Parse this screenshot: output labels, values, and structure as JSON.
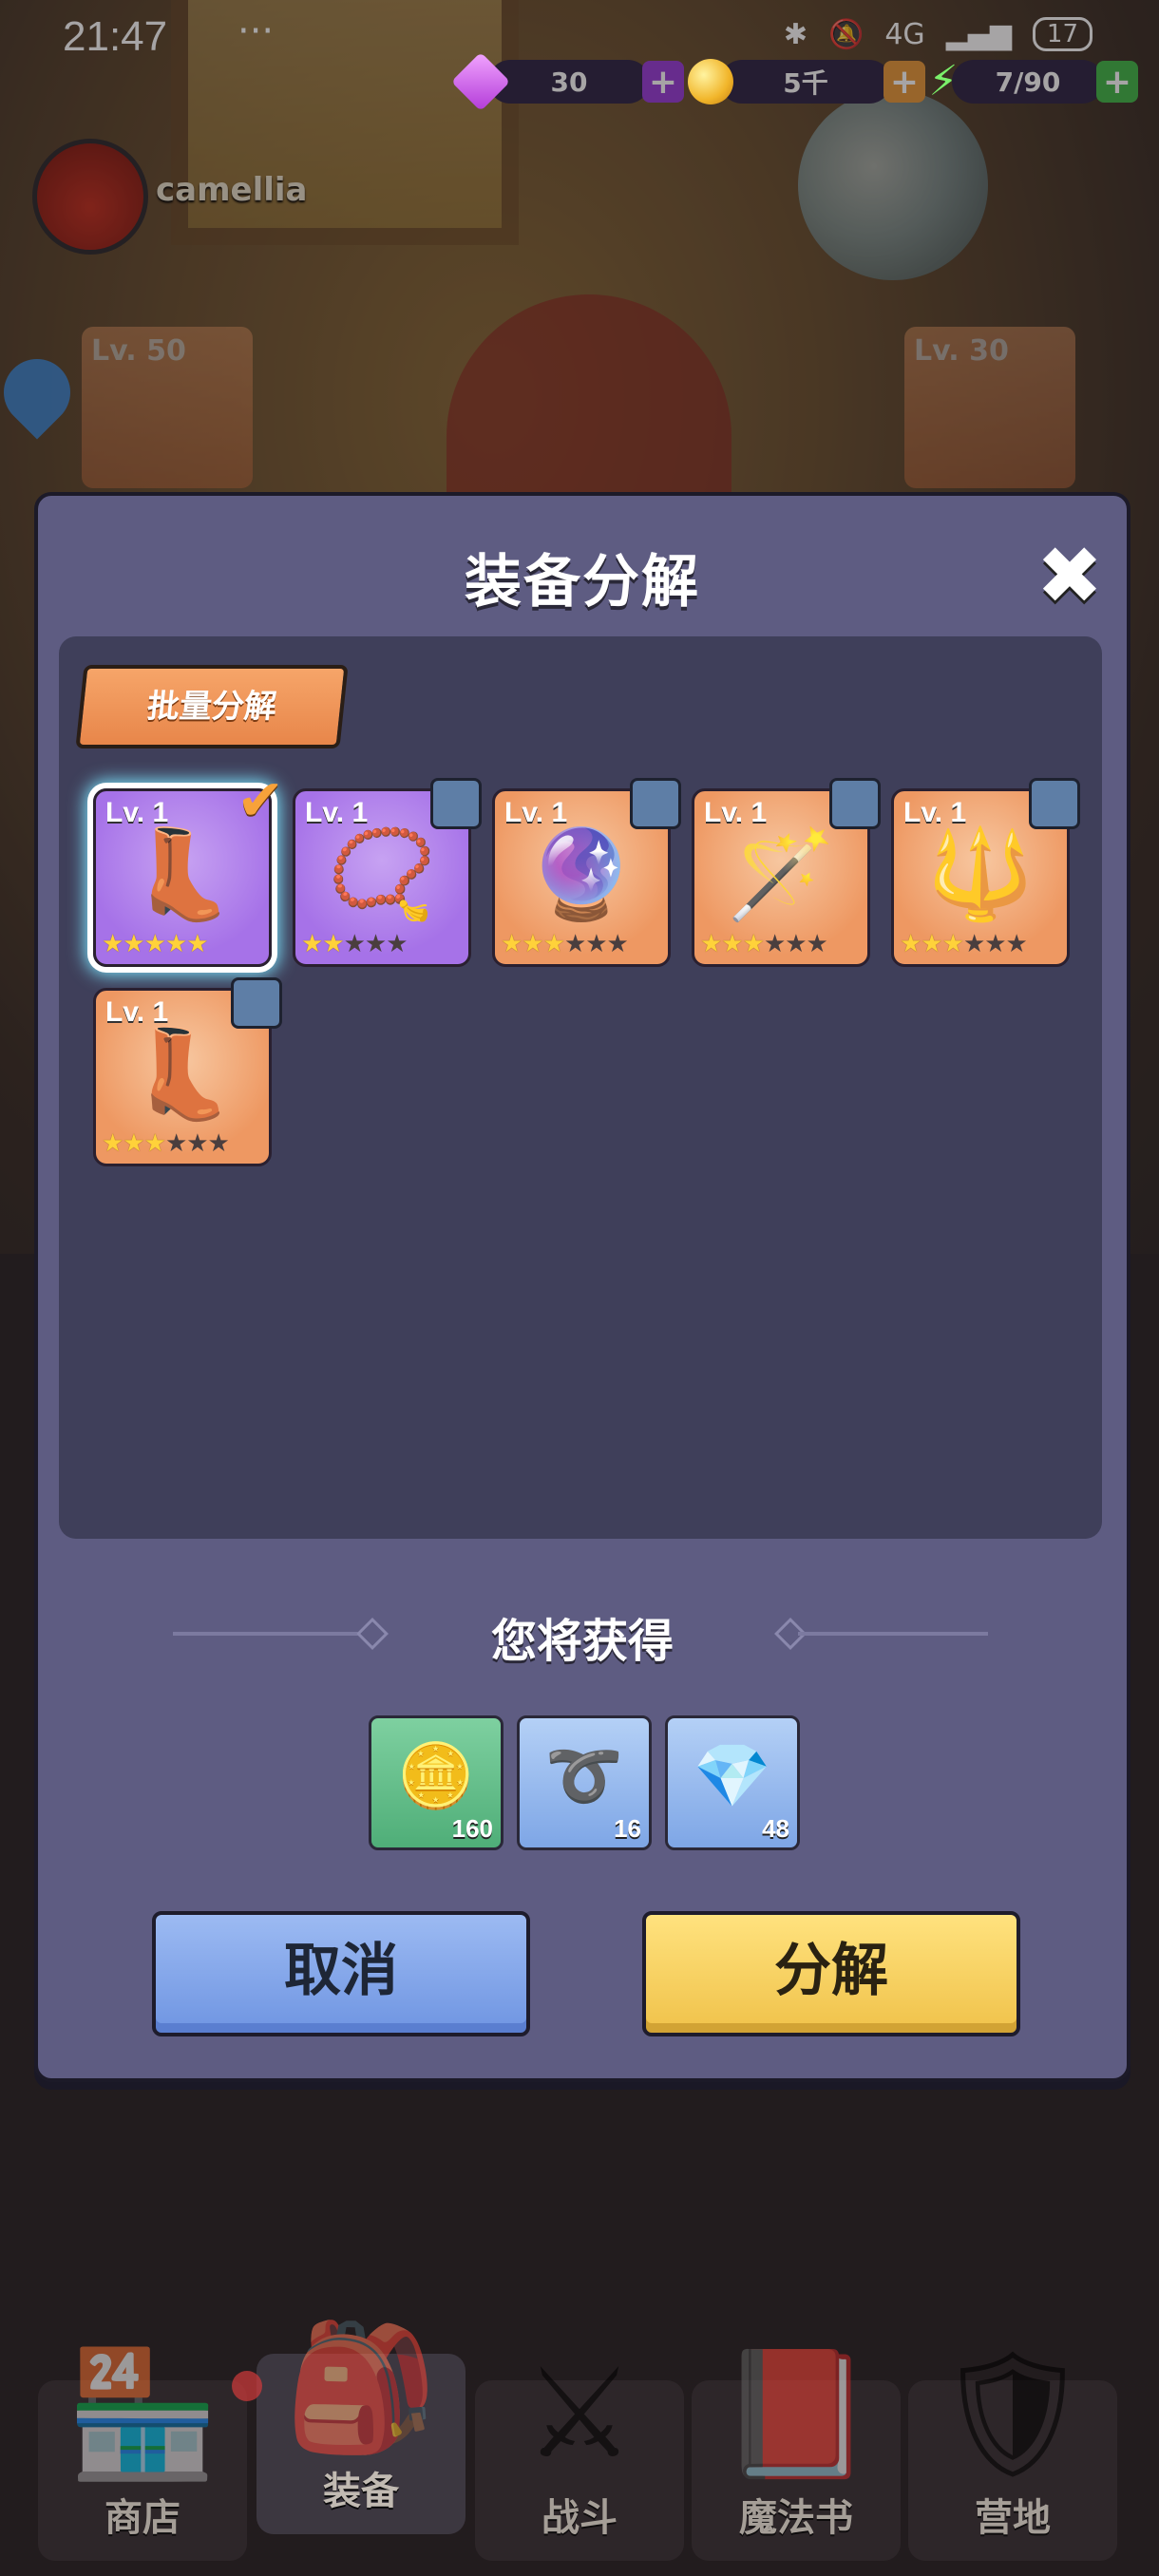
{
  "status_bar": {
    "time": "21:47",
    "more": "···",
    "network": "4G",
    "battery": "17"
  },
  "currencies": [
    {
      "icon": "gem-icon",
      "value": "30",
      "plus_color": "#9a3ed8"
    },
    {
      "icon": "coin-icon",
      "value": "5千",
      "plus_color": "#e89a3a"
    },
    {
      "icon": "energy-icon",
      "value": "7/90",
      "plus_color": "#43b84a"
    }
  ],
  "player": {
    "name": "camellia"
  },
  "background_items": [
    {
      "level": "Lv. 50"
    },
    {
      "level": "Lv. 30"
    }
  ],
  "modal": {
    "title": "装备分解",
    "close": "✖",
    "batch_label": "批量分解",
    "items": [
      {
        "level": "Lv. 1",
        "icon": "boots-icon",
        "rarity": "epic",
        "stars": 5,
        "selected": true
      },
      {
        "level": "Lv. 1",
        "icon": "necklace-icon",
        "rarity": "epic",
        "stars": 2,
        "selected": false
      },
      {
        "level": "Lv. 1",
        "icon": "staff-icon",
        "rarity": "orange",
        "stars": 3,
        "selected": false
      },
      {
        "level": "Lv. 1",
        "icon": "wand-icon",
        "rarity": "orange",
        "stars": 3,
        "selected": false
      },
      {
        "level": "Lv. 1",
        "icon": "trident-staff-icon",
        "rarity": "orange",
        "stars": 3,
        "selected": false
      },
      {
        "level": "Lv. 1",
        "icon": "boots-icon",
        "rarity": "orange",
        "stars": 3,
        "selected": false
      }
    ],
    "reward_label": "您将获得",
    "rewards": [
      {
        "icon": "coin-pile-icon",
        "count": "160",
        "color": "#5fbf86"
      },
      {
        "icon": "rope-icon",
        "count": "16",
        "color": "#8fb6ea"
      },
      {
        "icon": "crystal-icon",
        "count": "48",
        "color": "#8fb6ea"
      }
    ],
    "cancel_label": "取消",
    "confirm_label": "分解"
  },
  "bottom_nav": [
    {
      "label": "商店",
      "icon": "shop-icon",
      "active": false
    },
    {
      "label": "装备",
      "icon": "backpack-icon",
      "active": true
    },
    {
      "label": "战斗",
      "icon": "crossed-swords-icon",
      "active": false
    },
    {
      "label": "魔法书",
      "icon": "spellbook-icon",
      "active": false
    },
    {
      "label": "营地",
      "icon": "shield-crown-icon",
      "active": false
    }
  ]
}
